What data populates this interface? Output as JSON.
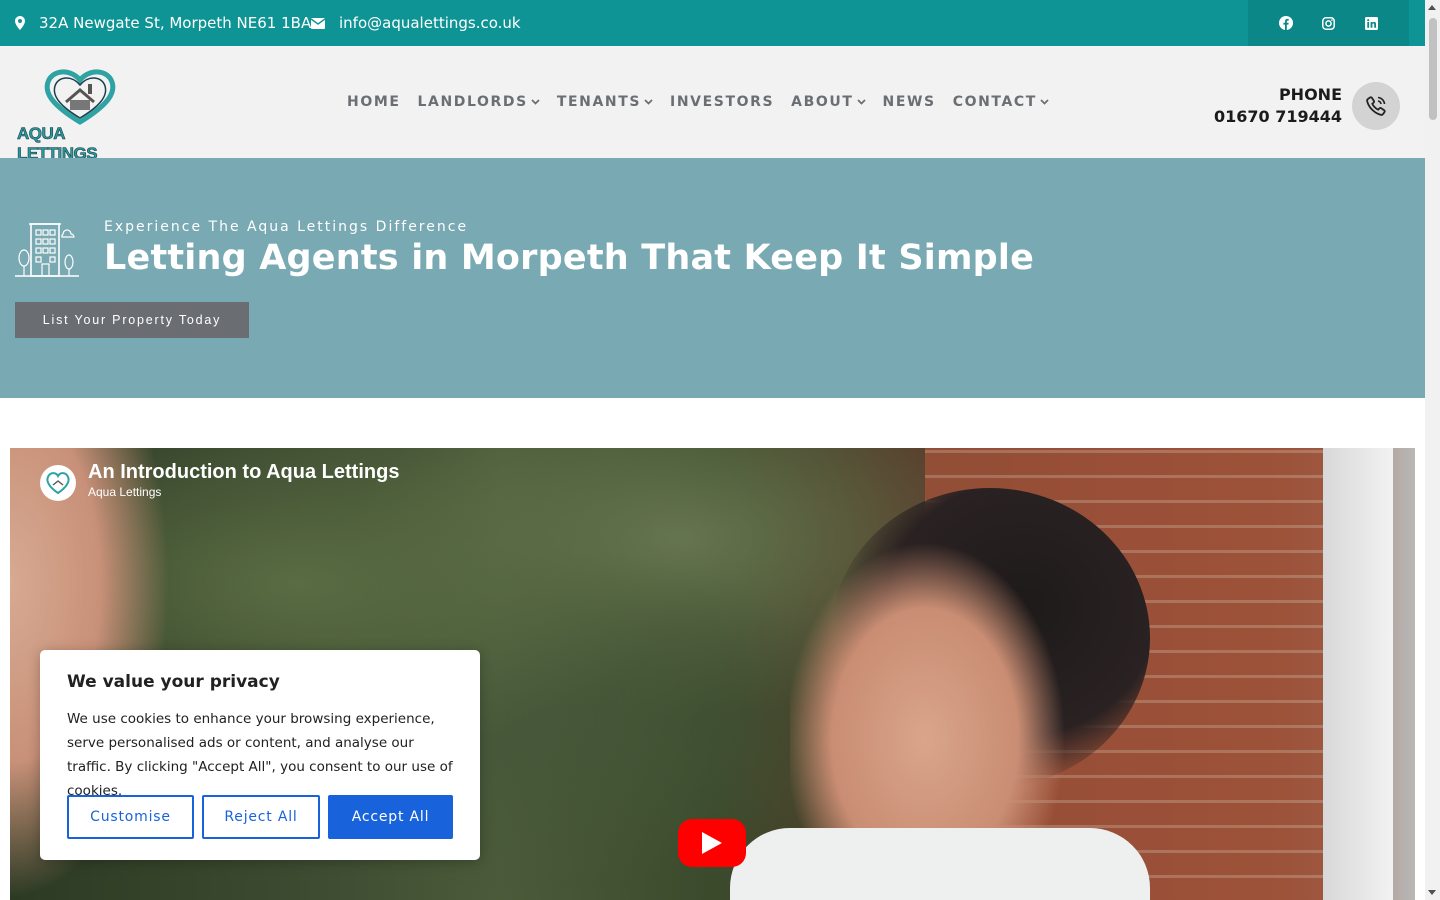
{
  "topbar": {
    "address": "32A Newgate St, Morpeth NE61 1BA",
    "email": "info@aqualettings.co.uk",
    "icons": [
      "map-pin-icon",
      "envelope-icon",
      "facebook-icon",
      "instagram-icon",
      "linkedin-icon"
    ]
  },
  "header": {
    "logo_text": "AQUA LETTINGS",
    "nav": [
      {
        "label": "HOME",
        "dropdown": false
      },
      {
        "label": "LANDLORDS",
        "dropdown": true
      },
      {
        "label": "TENANTS",
        "dropdown": true
      },
      {
        "label": "INVESTORS",
        "dropdown": false
      },
      {
        "label": "ABOUT",
        "dropdown": true
      },
      {
        "label": "NEWS",
        "dropdown": false
      },
      {
        "label": "CONTACT",
        "dropdown": true
      }
    ],
    "phone_label": "PHONE",
    "phone_number": "01670 719444"
  },
  "hero": {
    "subtitle": "Experience The Aqua Lettings Difference",
    "title": "Letting Agents in Morpeth That Keep It Simple",
    "button": "List Your Property Today"
  },
  "video": {
    "title": "An Introduction to Aqua Lettings",
    "channel": "Aqua Lettings"
  },
  "cookie": {
    "title": "We value your privacy",
    "text": "We use cookies to enhance your browsing experience, serve personalised ads or content, and analyse our traffic. By clicking \"Accept All\", you consent to our use of cookies.",
    "customise": "Customise",
    "reject": "Reject All",
    "accept": "Accept All"
  },
  "colors": {
    "topbar": "#0e9494",
    "hero": "#79a9b3",
    "accent_blue": "#1863dc",
    "youtube_red": "#ff0000"
  }
}
